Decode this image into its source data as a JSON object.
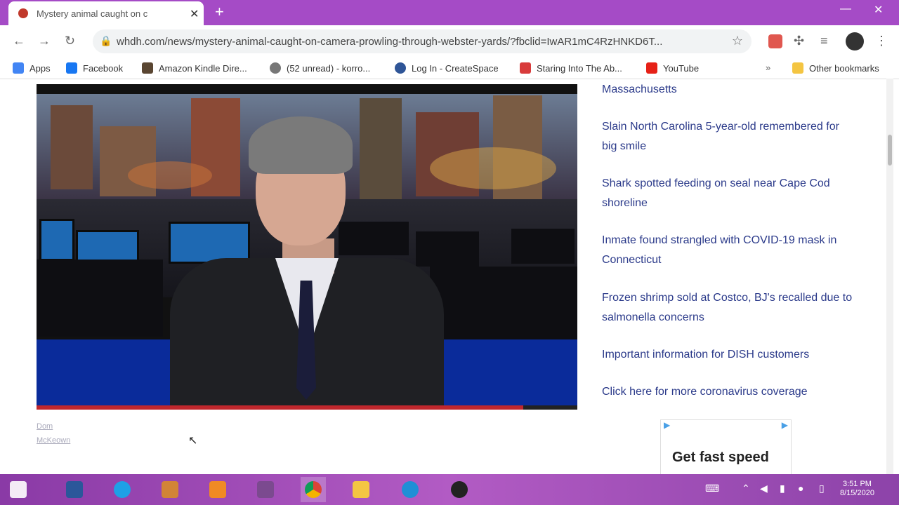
{
  "browser": {
    "tab_title": "Mystery animal caught on c",
    "new_tab": "+",
    "url": "whdh.com/news/mystery-animal-caught-on-camera-prowling-through-webster-yards/?fbclid=IwAR1mC4RzHNKD6T...",
    "bookmarks": [
      {
        "label": "Apps",
        "color": "#4285f4"
      },
      {
        "label": "Facebook",
        "color": "#1877f2"
      },
      {
        "label": "Amazon Kindle Dire...",
        "color": "#5a4632"
      },
      {
        "label": "(52 unread) - korro...",
        "color": "#777777"
      },
      {
        "label": "Log In - CreateSpace",
        "color": "#2f5597"
      },
      {
        "label": "Staring Into The Ab...",
        "color": "#d83b3b"
      },
      {
        "label": "YouTube",
        "color": "#e62117"
      }
    ],
    "other_bookmarks": "Other bookmarks"
  },
  "video": {
    "progress": 0.9
  },
  "caption": {
    "line1": "Dom",
    "line2": "McKeown"
  },
  "sidebar": {
    "top_partial": "Massachusetts",
    "links": [
      "Slain North Carolina 5-year-old remembered for big smile",
      "Shark spotted feeding on seal near Cape Cod shoreline",
      "Inmate found strangled with COVID-19 mask in Connecticut",
      "Frozen shrimp sold at Costco, BJ's recalled due to salmonella concerns",
      "Important information for DISH customers",
      "Click here for more coronavirus coverage"
    ]
  },
  "ad": {
    "headline": "Get fast speed"
  },
  "taskbar": {
    "clock_time": "3:51 PM",
    "clock_date": "8/15/2020"
  }
}
